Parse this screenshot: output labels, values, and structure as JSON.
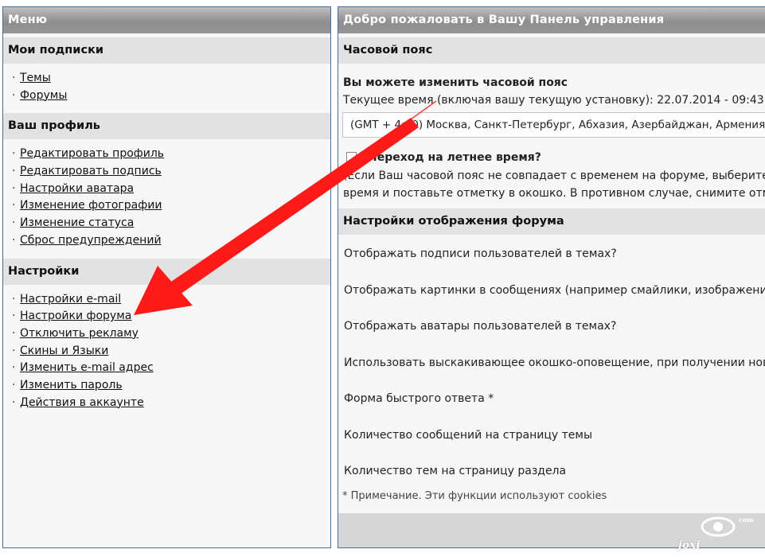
{
  "menu": {
    "title": "Меню",
    "sections": [
      {
        "title": "Мои подписки",
        "items": [
          "Темы",
          "Форумы"
        ]
      },
      {
        "title": "Ваш профиль",
        "items": [
          "Редактировать профиль",
          "Редактировать подпись",
          "Настройки аватара",
          "Изменение фотографии",
          "Изменение статуса",
          "Сброс предупреждений"
        ]
      },
      {
        "title": "Настройки",
        "items": [
          "Настройки e-mail",
          "Настройки форума",
          "Отключить рекламу",
          "Скины и Языки",
          "Изменить e-mail адрес",
          "Изменить пароль",
          "Действия в аккаунте"
        ]
      }
    ]
  },
  "main": {
    "title": "Добро пожаловать в Вашу Панель управления",
    "timezone": {
      "section_title": "Часовой пояс",
      "heading": "Вы можете изменить часовой пояс",
      "current_time": "Текущее время (включая вашу текущую установку): 22.07.2014 - 09:43",
      "selected": "(GMT + 4:00) Москва, Санкт-Петербург, Абхазия, Азербайджан, Армения,",
      "dst_label": "Переход на летнее время?",
      "dst_checked": false,
      "note_line1": "(Если Ваш часовой пояс не совпадает с временем на форуме, выберите",
      "note_line2": "время и поставьте отметку в окошко. В противном случае, снимите отм"
    },
    "display": {
      "section_title": "Настройки отображения форума",
      "items": [
        "Отображать подписи пользователей в темах?",
        "Отображать картинки в сообщениях (например смайлики, изображения",
        "Отображать аватары пользователей в темах?",
        "Использовать выскакивающее окошко-оповещение, при получении нов",
        "Форма быстрого ответа *",
        "Количество сообщений на страницу темы",
        "Количество тем на страницу раздела"
      ],
      "footnote": "* Примечание. Эти функции используют cookies"
    }
  },
  "overlay": {
    "arrow_color": "#ff1a1a",
    "watermark_text": "joxi",
    "watermark_suffix": "com"
  }
}
